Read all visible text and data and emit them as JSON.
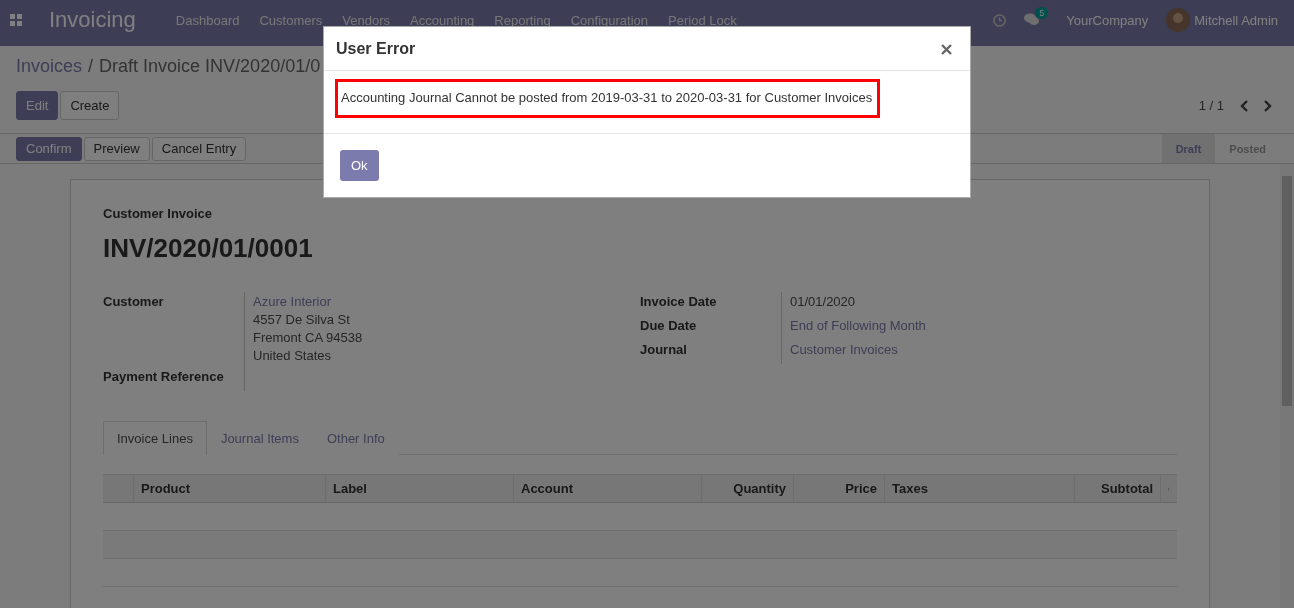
{
  "navbar": {
    "app_title": "Invoicing",
    "menu": [
      "Dashboard",
      "Customers",
      "Vendors",
      "Accounting",
      "Reporting",
      "Configuration",
      "Period Lock"
    ],
    "messages_badge": "5",
    "company": "YourCompany",
    "user": "Mitchell Admin"
  },
  "breadcrumb_separator": "/",
  "breadcrumb": [
    {
      "label": "Invoices",
      "kind": "link"
    },
    {
      "label": "Draft Invoice INV/2020/01/0",
      "kind": "current"
    }
  ],
  "buttons": [
    {
      "label": "Edit",
      "kind": "primary"
    },
    {
      "label": "Create",
      "kind": "secondary"
    }
  ],
  "pager": "1 / 1",
  "header_buttons": [
    {
      "label": "Confirm",
      "kind": "primary"
    },
    {
      "label": "Preview",
      "kind": "secondary"
    },
    {
      "label": "Cancel Entry",
      "kind": "secondary"
    }
  ],
  "stages": [
    {
      "label": "Draft",
      "selected": true
    },
    {
      "label": "Posted",
      "selected": false
    }
  ],
  "sheet": {
    "subtitle": "Customer Invoice",
    "title": "INV/2020/01/0001",
    "left_fields": [
      {
        "label": "Customer",
        "values": [
          {
            "text": "Azure Interior",
            "kind": "link"
          },
          {
            "text": "4557 De Silva St",
            "kind": "plain"
          },
          {
            "text": "Fremont CA 94538",
            "kind": "plain"
          },
          {
            "text": "United States",
            "kind": "plain"
          }
        ]
      },
      {
        "label": "Payment Reference"
      }
    ],
    "right_fields": [
      {
        "label": "Invoice Date",
        "values": [
          {
            "text": "01/01/2020",
            "kind": "plain"
          }
        ]
      },
      {
        "label": "Due Date",
        "values": [
          {
            "text": "End of Following Month",
            "kind": "link"
          }
        ]
      },
      {
        "label": "Journal",
        "values": [
          {
            "text": "Customer Invoices",
            "kind": "link"
          }
        ]
      }
    ],
    "tabs": [
      {
        "label": "Invoice Lines",
        "selected": true
      },
      {
        "label": "Journal Items",
        "selected": false
      },
      {
        "label": "Other Info",
        "selected": false
      }
    ],
    "table": {
      "columns": [
        {
          "label": "Product",
          "kind": "text"
        },
        {
          "label": "Label",
          "kind": "text"
        },
        {
          "label": "Account",
          "kind": "text"
        },
        {
          "label": "Quantity",
          "kind": "number"
        },
        {
          "label": "Price",
          "kind": "number"
        },
        {
          "label": "Taxes",
          "kind": "text"
        },
        {
          "label": "Subtotal",
          "kind": "number"
        }
      ]
    }
  },
  "dialog": {
    "title": "User Error",
    "message": "Accounting Journal Cannot be posted from 2019-03-31 to 2020-03-31 for Customer Invoices",
    "button": "Ok"
  }
}
